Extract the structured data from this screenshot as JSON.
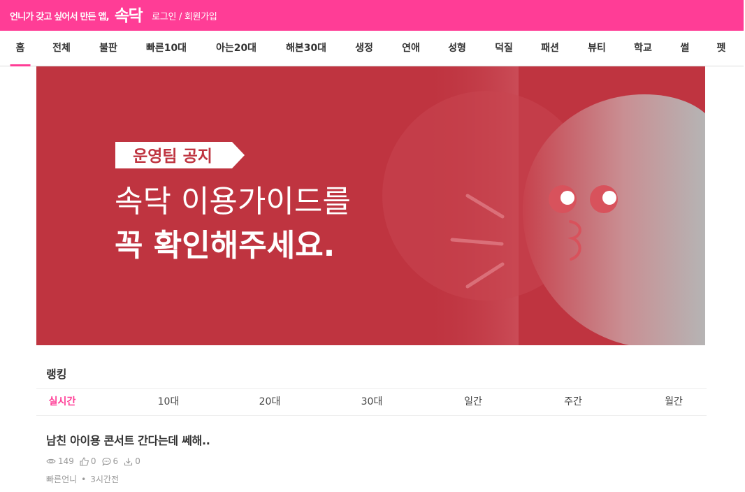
{
  "header": {
    "tagline": "언니가 갖고 싶어서 만든 앱,",
    "logo": "속닥",
    "login_label": "로그인",
    "separator": " / ",
    "signup_label": "회원가입",
    "brand_color": "#ff3d96"
  },
  "nav": {
    "items": [
      "홈",
      "전체",
      "불판",
      "빠른10대",
      "아는20대",
      "해본30대",
      "생정",
      "연애",
      "성형",
      "덕질",
      "패션",
      "뷰티",
      "학교",
      "썰",
      "펫"
    ],
    "active_index": 0
  },
  "banner": {
    "badge": "운영팀 공지",
    "line1": "속닥 이용가이드를",
    "line2": "꼭 확인해주세요.",
    "background_color": "#bf3440",
    "mascot": "pink-blob-mascot"
  },
  "ranking": {
    "title": "랭킹",
    "tabs": [
      "실시간",
      "10대",
      "20대",
      "30대",
      "일간",
      "주간",
      "월간"
    ],
    "active_index": 0
  },
  "post": {
    "title": "남친 아이용 콘서트 간다는데 쎄해..",
    "views": "149",
    "likes": "0",
    "comments": "6",
    "scraps": "0",
    "author": "빠른언니",
    "meta_separator": "•",
    "time": "3시간전"
  }
}
